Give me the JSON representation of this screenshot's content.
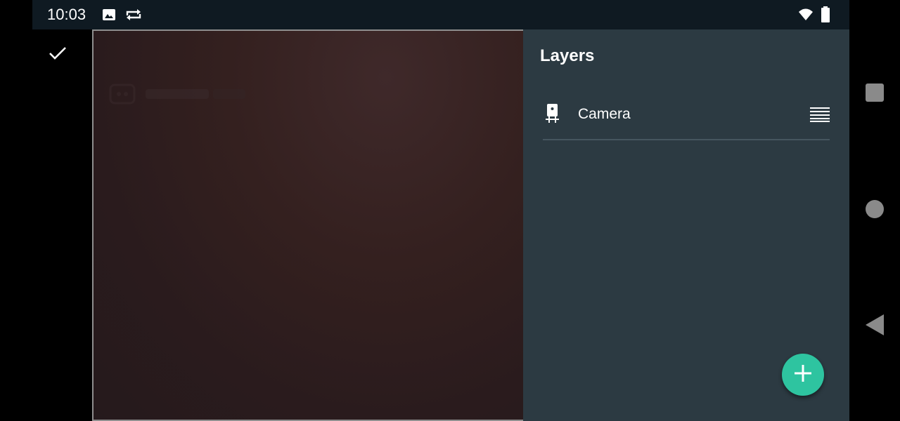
{
  "status_bar": {
    "time": "10:03",
    "icons": [
      "image-icon",
      "sync-icon",
      "wifi-icon",
      "battery-icon"
    ]
  },
  "toolbar": {
    "confirm_icon": "check-icon"
  },
  "layers_panel": {
    "title": "Layers",
    "items": [
      {
        "label": "Camera",
        "icon": "camera-device-icon",
        "handle_icon": "drag-handle-icon"
      }
    ],
    "add_button_icon": "plus-icon"
  },
  "nav_bar": {
    "buttons": [
      "recents-button",
      "home-button",
      "back-button"
    ]
  },
  "colors": {
    "panel_background": "#2c3a42",
    "fab": "#2ec4a0",
    "status_bar": "#0f1a22"
  }
}
